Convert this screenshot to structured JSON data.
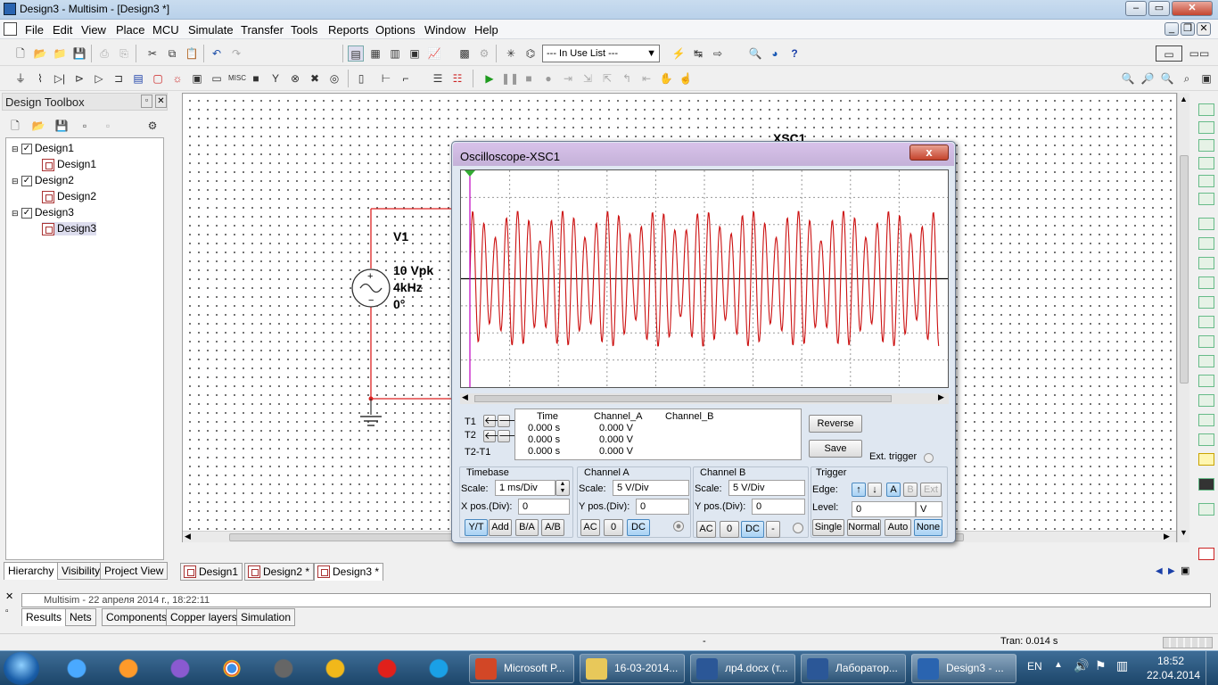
{
  "window": {
    "title": "Design3 - Multisim - [Design3 *]"
  },
  "menu": [
    "File",
    "Edit",
    "View",
    "Place",
    "MCU",
    "Simulate",
    "Transfer",
    "Tools",
    "Reports",
    "Options",
    "Window",
    "Help"
  ],
  "toolbar": {
    "in_use_list": "--- In Use List ---"
  },
  "toolbox": {
    "title": "Design Toolbox",
    "tree": [
      {
        "label": "Design1",
        "child": "Design1"
      },
      {
        "label": "Design2",
        "child": "Design2"
      },
      {
        "label": "Design3",
        "child": "Design3"
      }
    ],
    "tabs": [
      "Hierarchy",
      "Visibility",
      "Project View"
    ]
  },
  "schematic": {
    "source_ref": "V1",
    "source_amplitude": "10 Vpk",
    "source_freq": "4kHz",
    "source_phase": "0°",
    "scope_ref": "XSC1"
  },
  "doc_tabs": [
    "Design1",
    "Design2 *",
    "Design3 *"
  ],
  "oscilloscope": {
    "title": "Oscilloscope-XSC1",
    "close": "x",
    "readout": {
      "headers": [
        "Time",
        "Channel_A",
        "Channel_B"
      ],
      "rows": [
        {
          "label": "T1",
          "time": "0.000 s",
          "a": "0.000 V"
        },
        {
          "label": "T2",
          "time": "0.000 s",
          "a": "0.000 V"
        },
        {
          "label": "T2-T1",
          "time": "0.000 s",
          "a": "0.000 V"
        }
      ]
    },
    "reverse": "Reverse",
    "save": "Save",
    "ext_trigger": "Ext. trigger",
    "timebase": {
      "title": "Timebase",
      "scale_label": "Scale:",
      "scale": "1 ms/Div",
      "xpos_label": "X pos.(Div):",
      "xpos": "0",
      "modes": [
        "Y/T",
        "Add",
        "B/A",
        "A/B"
      ]
    },
    "channel_a": {
      "title": "Channel A",
      "scale_label": "Scale:",
      "scale": "5  V/Div",
      "ypos_label": "Y pos.(Div):",
      "ypos": "0",
      "coupling": [
        "AC",
        "0",
        "DC"
      ]
    },
    "channel_b": {
      "title": "Channel B",
      "scale_label": "Scale:",
      "scale": "5  V/Div",
      "ypos_label": "Y pos.(Div):",
      "ypos": "0",
      "coupling": [
        "AC",
        "0",
        "DC",
        "-"
      ]
    },
    "trigger": {
      "title": "Trigger",
      "edge_label": "Edge:",
      "sources": [
        "A",
        "B",
        "Ext"
      ],
      "level_label": "Level:",
      "level": "0",
      "level_unit": "V",
      "modes": [
        "Single",
        "Normal",
        "Auto",
        "None"
      ]
    }
  },
  "results": {
    "log": "Multisim  -  22 апреля 2014 г., 18:22:11",
    "tabs": [
      "Results",
      "Nets",
      "Components",
      "Copper layers",
      "Simulation"
    ]
  },
  "status": {
    "center": "-",
    "tran": "Tran: 0.014 s"
  },
  "taskbar": {
    "apps": [
      "Microsoft P...",
      "16-03-2014...",
      "лр4.docx (т...",
      "Лаборатор...",
      "Design3 - ..."
    ],
    "lang": "EN",
    "time": "18:52",
    "date": "22.04.2014"
  }
}
